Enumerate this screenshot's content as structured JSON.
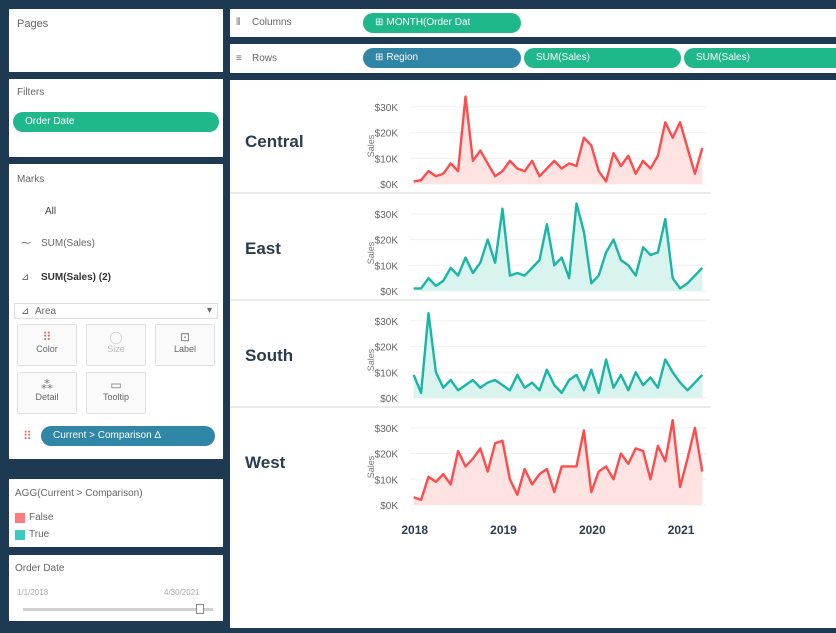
{
  "pages": {
    "title": "Pages"
  },
  "shelves": {
    "columns_label": "Columns",
    "rows_label": "Rows",
    "columns_pill": "MONTH(Order Dat",
    "rows_pills": [
      "Region",
      "SUM(Sales)",
      "SUM(Sales)"
    ]
  },
  "filters": {
    "title": "Filters",
    "pill": "Order Date"
  },
  "marks": {
    "title": "Marks",
    "rows": [
      "All",
      "SUM(Sales)",
      "SUM(Sales) (2)"
    ],
    "mark_type": "Area",
    "cards": [
      "Color",
      "Size",
      "Label",
      "Detail",
      "Tooltip"
    ],
    "color_pill": "Current > Comparison Δ"
  },
  "legend": {
    "title": "AGG(Current > Comparison)",
    "items": [
      {
        "label": "False",
        "color": "#ff7b7b"
      },
      {
        "label": "True",
        "color": "#3ccbbf"
      }
    ]
  },
  "date_filter": {
    "title": "Order Date",
    "start": "1/1/2018",
    "end": "4/30/2021",
    "handle_position": 0.93
  },
  "chart_data": {
    "type": "area",
    "xlabel": "",
    "ylabel": "Sales",
    "x_ticks": [
      "2018",
      "2019",
      "2020",
      "2021"
    ],
    "y_ticks": [
      "$30K",
      "$20K",
      "$10K",
      "$0K"
    ],
    "ylim": [
      0,
      35000
    ],
    "months": [
      "2018-01",
      "2018-02",
      "2018-03",
      "2018-04",
      "2018-05",
      "2018-06",
      "2018-07",
      "2018-08",
      "2018-09",
      "2018-10",
      "2018-11",
      "2018-12",
      "2019-01",
      "2019-02",
      "2019-03",
      "2019-04",
      "2019-05",
      "2019-06",
      "2019-07",
      "2019-08",
      "2019-09",
      "2019-10",
      "2019-11",
      "2019-12",
      "2020-01",
      "2020-02",
      "2020-03",
      "2020-04",
      "2020-05",
      "2020-06",
      "2020-07",
      "2020-08",
      "2020-09",
      "2020-10",
      "2020-11",
      "2020-12",
      "2021-01",
      "2021-02",
      "2021-03",
      "2021-04"
    ],
    "series": [
      {
        "name": "Central",
        "color": "#ff4b4b",
        "fill": "#ffe3e3",
        "values": [
          1000,
          1500,
          5000,
          3000,
          4000,
          8000,
          5000,
          34000,
          9000,
          13000,
          8000,
          3000,
          5000,
          9000,
          6000,
          5000,
          9000,
          3000,
          6000,
          9000,
          6000,
          8000,
          7000,
          18000,
          15000,
          5000,
          1000,
          12000,
          7000,
          11000,
          4000,
          9000,
          6000,
          11000,
          24000,
          18000,
          24000,
          14000,
          4000,
          14000
        ]
      },
      {
        "name": "East",
        "color": "#17b6a6",
        "fill": "#d9f3ef",
        "values": [
          1000,
          1000,
          5000,
          2000,
          4000,
          9000,
          6000,
          13000,
          7000,
          11000,
          20000,
          11000,
          32000,
          6000,
          7000,
          6000,
          9000,
          12000,
          26000,
          10000,
          13000,
          5000,
          34000,
          23000,
          3000,
          6000,
          15000,
          20000,
          12000,
          10000,
          6000,
          17000,
          14000,
          15000,
          28000,
          5000,
          1000,
          3000,
          6000,
          9000
        ]
      },
      {
        "name": "South",
        "color": "#17b6a6",
        "fill": "#d9f3ef",
        "values": [
          9000,
          2000,
          33000,
          10000,
          4000,
          7000,
          3000,
          5000,
          7000,
          4000,
          6000,
          7000,
          5000,
          3000,
          9000,
          4000,
          6000,
          3000,
          11000,
          5000,
          2000,
          7000,
          9000,
          3000,
          11000,
          2000,
          15000,
          4000,
          9000,
          3000,
          10000,
          5000,
          8000,
          4000,
          15000,
          10000,
          6000,
          3000,
          6000,
          9000
        ]
      },
      {
        "name": "West",
        "color": "#ff4b4b",
        "fill": "#ffe3e3",
        "values": [
          3000,
          2000,
          11000,
          9000,
          12000,
          8000,
          21000,
          15000,
          18000,
          22000,
          13000,
          24000,
          25000,
          10000,
          4000,
          14000,
          8000,
          12000,
          14000,
          5000,
          15000,
          15000,
          15000,
          29000,
          5000,
          13000,
          15000,
          10000,
          20000,
          16000,
          22000,
          21000,
          10000,
          23000,
          17000,
          33000,
          7000,
          18000,
          30000,
          13000
        ]
      }
    ]
  }
}
